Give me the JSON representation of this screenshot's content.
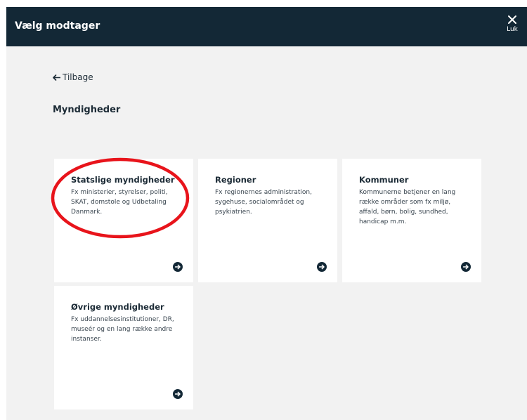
{
  "header": {
    "title": "Vælg modtager",
    "close_label": "Luk"
  },
  "nav": {
    "back_label": "Tilbage"
  },
  "section": {
    "title": "Myndigheder"
  },
  "cards": [
    {
      "title": "Statslige myndigheder",
      "description": "Fx ministerier, styrelser, politi, SKAT, domstole og Udbetaling Danmark."
    },
    {
      "title": "Regioner",
      "description": "Fx regionernes administration, sygehuse, socialområdet og psykiatrien."
    },
    {
      "title": "Kommuner",
      "description": "Kommunerne betjener en lang række områder som fx miljø, affald, børn, bolig, sundhed, handicap m.m."
    },
    {
      "title": "Øvrige myndigheder",
      "description": "Fx uddannelsesinstitutioner, DR, museér og en lang række andre instanser."
    }
  ],
  "icons": {
    "close": "close-icon",
    "back": "arrow-left-icon",
    "card_arrow": "arrow-right-circle-icon"
  },
  "colors": {
    "header_bg": "#132836",
    "page_bg": "#f2f2f2",
    "card_bg": "#ffffff",
    "annotation": "#e8141b"
  }
}
